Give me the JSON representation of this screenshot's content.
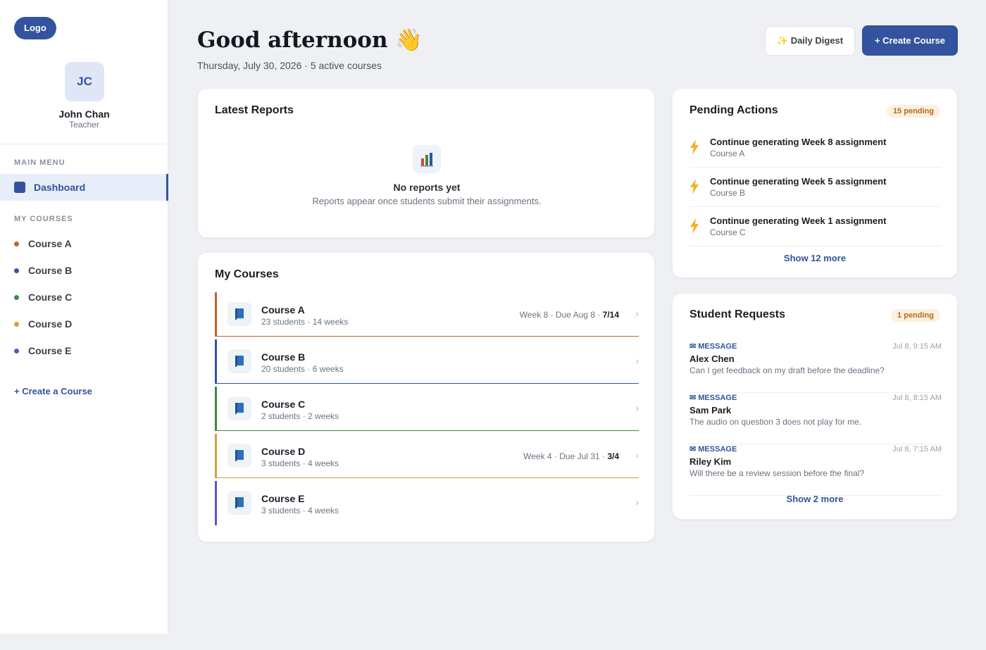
{
  "sidebar": {
    "logo": "Logo",
    "avatar_initials": "JC",
    "user_name": "John Chan",
    "user_role": "Teacher",
    "main_menu_label": "MAIN MENU",
    "dashboard_label": "Dashboard",
    "my_courses_label": "MY COURSES",
    "courses": [
      {
        "label": "Course A",
        "color": "#c0632c"
      },
      {
        "label": "Course B",
        "color": "#33539e"
      },
      {
        "label": "Course C",
        "color": "#3f8a3f"
      },
      {
        "label": "Course D",
        "color": "#d4a03a"
      },
      {
        "label": "Course E",
        "color": "#6a4fbf"
      }
    ],
    "create_course_link": "+ Create a Course"
  },
  "header": {
    "greeting": "Good afternoon 👋",
    "subtitle": "Thursday, July 30, 2026 · 5 active courses",
    "digest_button": "✨ Daily Digest",
    "create_button": "+ Create Course"
  },
  "reports": {
    "title": "Latest Reports",
    "empty_icon": "bar-chart-icon",
    "empty_title": "No reports yet",
    "empty_desc": "Reports appear once students submit their assignments."
  },
  "my_courses": {
    "title": "My Courses",
    "rows": [
      {
        "name": "Course A",
        "sub": "23 students · 14 weeks",
        "meta": "Week 8 · Due Aug 8 · ",
        "progress": "7/14",
        "color": "#c0632c"
      },
      {
        "name": "Course B",
        "sub": "20 students · 6 weeks",
        "meta": "",
        "progress": "",
        "color": "#33539e"
      },
      {
        "name": "Course C",
        "sub": "2 students · 2 weeks",
        "meta": "",
        "progress": "",
        "color": "#3f8a3f"
      },
      {
        "name": "Course D",
        "sub": "3 students · 4 weeks",
        "meta": "Week 4 · Due Jul 31 · ",
        "progress": "3/4",
        "color": "#d4a03a"
      },
      {
        "name": "Course E",
        "sub": "3 students · 4 weeks",
        "meta": "",
        "progress": "",
        "color": "#6a4fbf"
      }
    ]
  },
  "pending": {
    "title": "Pending Actions",
    "badge": "15 pending",
    "items": [
      {
        "title": "Continue generating Week 8 assignment",
        "course": "Course A"
      },
      {
        "title": "Continue generating Week 5 assignment",
        "course": "Course B"
      },
      {
        "title": "Continue generating Week 1 assignment",
        "course": "Course C"
      }
    ],
    "show_more": "Show 12 more"
  },
  "requests": {
    "title": "Student Requests",
    "badge": "1 pending",
    "items": [
      {
        "type": "✉ MESSAGE",
        "time": "Jul 8, 9:15 AM",
        "name": "Alex Chen",
        "message": "Can I get feedback on my draft before the deadline?"
      },
      {
        "type": "✉ MESSAGE",
        "time": "Jul 8, 8:15 AM",
        "name": "Sam Park",
        "message": "The audio on question 3 does not play for me."
      },
      {
        "type": "✉ MESSAGE",
        "time": "Jul 8, 7:15 AM",
        "name": "Riley Kim",
        "message": "Will there be a review session before the final?"
      }
    ],
    "show_more": "Show 2 more"
  }
}
